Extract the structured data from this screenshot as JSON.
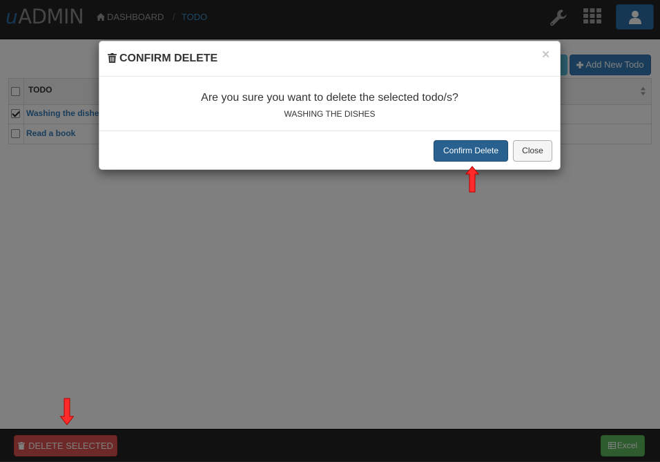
{
  "navbar": {
    "brand_prefix": "u",
    "brand_name": "ADMIN",
    "breadcrumb": {
      "home_icon": "home-icon",
      "dashboard_label": "DASHBOARD",
      "separator": "/",
      "current_label": "TODO"
    },
    "icons": [
      "wrench-icon",
      "apps-grid-icon",
      "user-icon"
    ]
  },
  "toolbar": {
    "add_new_label": "Add New Todo",
    "add_icon": "plus-icon"
  },
  "table": {
    "header_label": "TODO",
    "sort_icon": "sort-icon",
    "rows": [
      {
        "text": "Washing the dishes",
        "checked": true
      },
      {
        "text": "Read a book",
        "checked": false
      }
    ]
  },
  "footer": {
    "delete_selected_label": "DELETE SELECTED",
    "delete_icon": "trash-icon",
    "excel_label": "Excel",
    "excel_icon": "table-icon"
  },
  "modal": {
    "title": "CONFIRM DELETE",
    "title_icon": "trash-icon",
    "close_symbol": "×",
    "question": "Are you sure you want to delete the selected todo/s?",
    "item": "WASHING THE DISHES",
    "confirm_label": "Confirm Delete",
    "close_label": "Close"
  },
  "colors": {
    "navbar_bg": "#222222",
    "primary": "#337ab7",
    "confirm": "#286090",
    "danger": "#d9534f",
    "success": "#5cb85c",
    "annotation_arrow": "#ff2a2a"
  }
}
